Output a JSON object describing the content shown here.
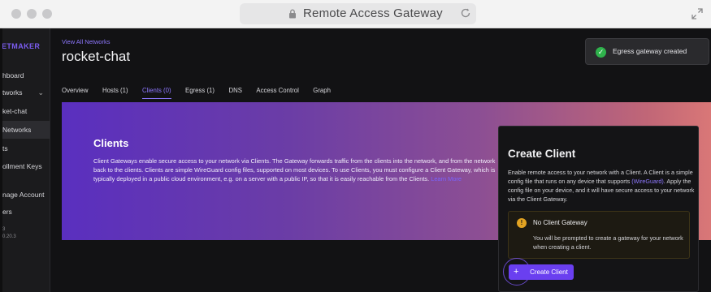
{
  "browser": {
    "title": "Remote Access Gateway"
  },
  "sidebar": {
    "brand": "ETMAKER",
    "items": [
      {
        "label": "hboard"
      },
      {
        "label": "tworks"
      },
      {
        "label": "ket-chat"
      },
      {
        "label": "Networks"
      },
      {
        "label": "ts"
      },
      {
        "label": "ollment Keys"
      },
      {
        "label": "nage Account"
      },
      {
        "label": "ers"
      }
    ],
    "version_a": "3",
    "version_b": "0.20.3"
  },
  "header": {
    "view_all": "View All Networks",
    "network_name": "rocket-chat"
  },
  "tabs": [
    {
      "label": "Overview"
    },
    {
      "label": "Hosts (1)"
    },
    {
      "label": "Clients (0)"
    },
    {
      "label": "Egress (1)"
    },
    {
      "label": "DNS"
    },
    {
      "label": "Access Control"
    },
    {
      "label": "Graph"
    }
  ],
  "toast": {
    "message": "Egress gateway created"
  },
  "hero": {
    "title": "Clients",
    "body": "Client Gateways enable secure access to your network via Clients. The Gateway forwards traffic from the clients into the network, and from the network back to the clients. Clients are simple WireGuard config files, supported on most devices. To use Clients, you must configure a Client Gateway, which is typically deployed in a public cloud environment, e.g. on a server with a public IP, so that it is easily reachable from the Clients.",
    "learn_more": "Learn More"
  },
  "panel": {
    "title": "Create Client",
    "desc_a": "Enable remote access to your network with a Client. A Client is a simple config file that runs on any device that supports ",
    "desc_link": "(WireGuard)",
    "desc_b": ". Apply the config file on your device, and it will have secure access to your network via the Client Gateway.",
    "warning_title": "No Client Gateway",
    "warning_body": "You will be prompted to create a gateway for your network when creating a client.",
    "button": "Create Client"
  },
  "colors": {
    "accent": "#8e78ff",
    "button": "#6a3ff0",
    "success": "#2fb24c",
    "warning": "#e2a322"
  }
}
